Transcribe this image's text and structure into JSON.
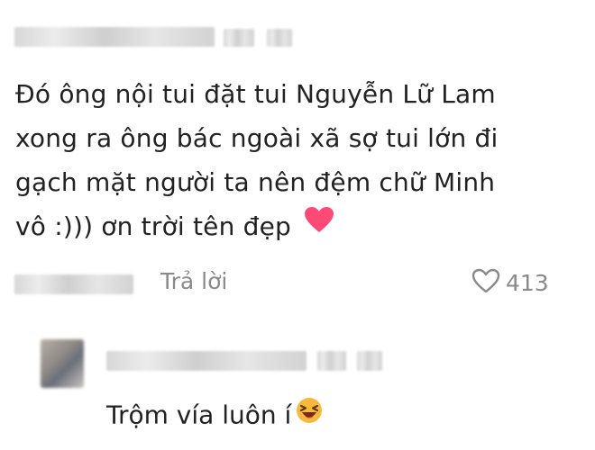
{
  "comment": {
    "lines": [
      "Đó ông nội tui đặt tui Nguyễn Lữ Lam",
      "xong ra ông bác ngoài xã sợ tui lớn đi",
      "gạch mặt người ta nên đệm chữ Minh",
      "vô :))) ơn trời tên đẹp"
    ],
    "emoji_icon": "heart-emoji",
    "reply_label": "Trả lời",
    "like_count": "413",
    "like_icon": "heart-outline-icon"
  },
  "reply": {
    "text": "Trộm vía luôn í",
    "emoji_icon": "laughing-face-emoji"
  },
  "colors": {
    "text": "#222222",
    "muted": "#8a8a8a",
    "heart": "#fe2c55"
  }
}
